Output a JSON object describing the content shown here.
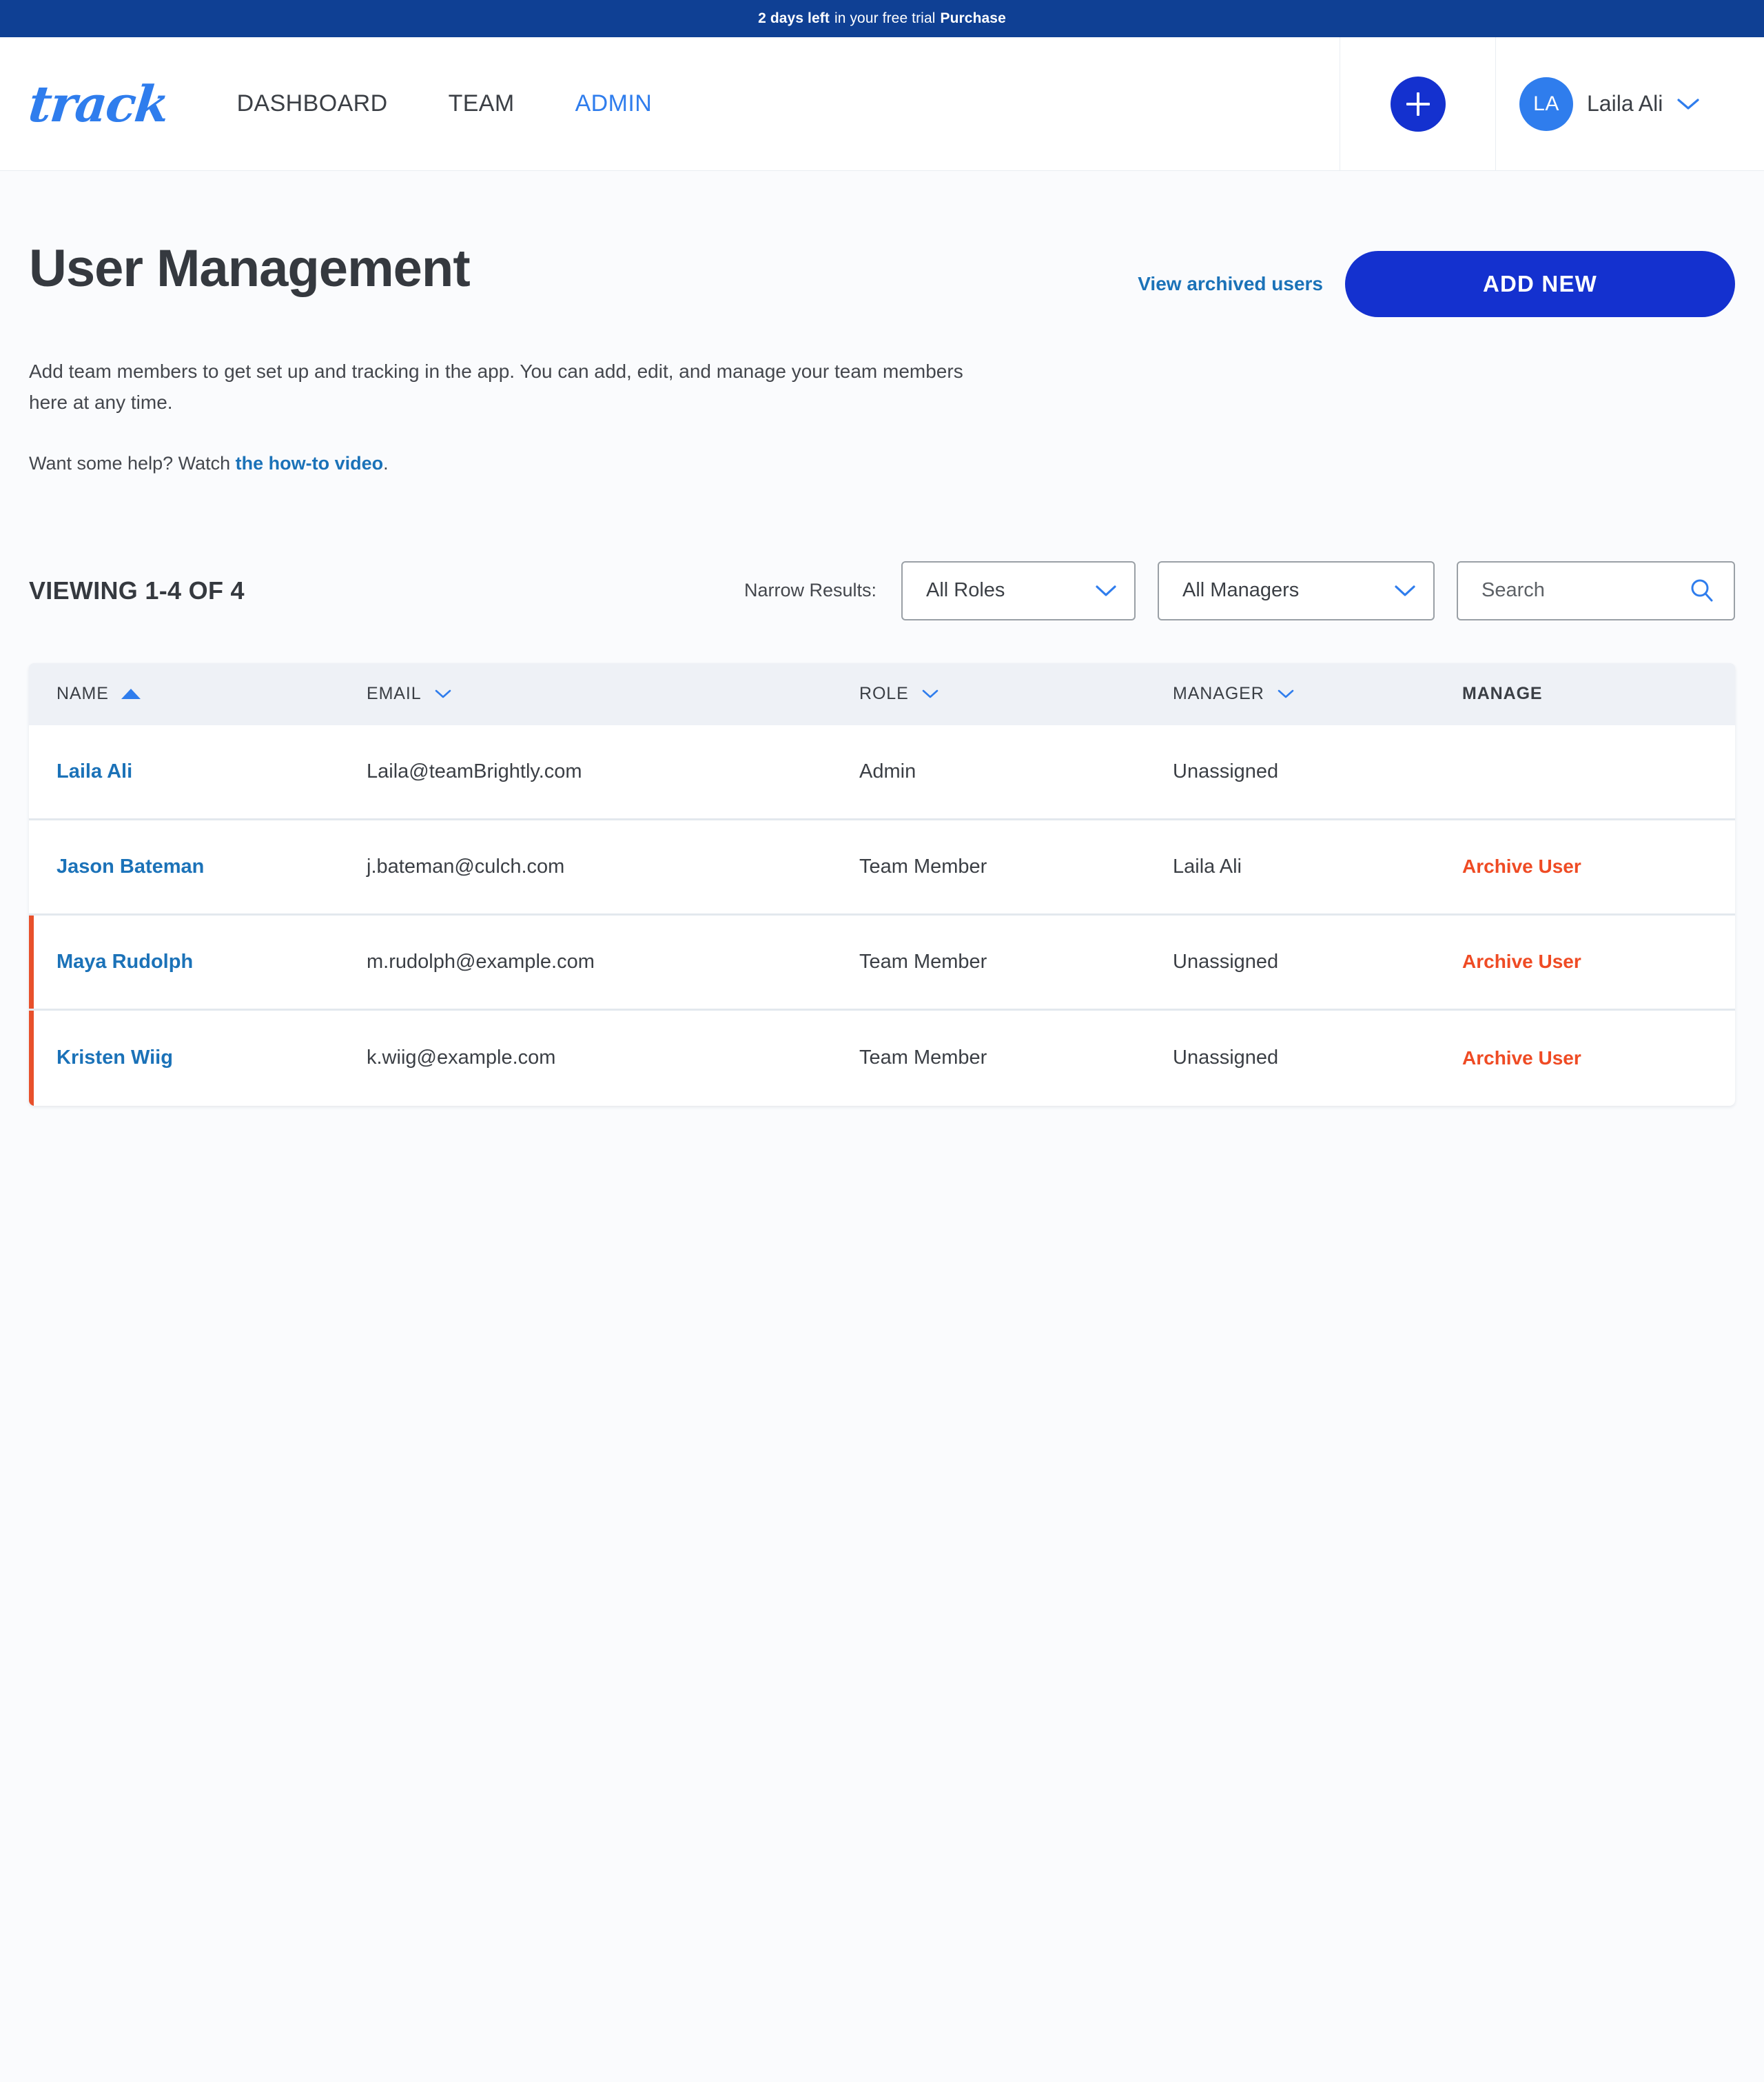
{
  "banner": {
    "bold_prefix": "2 days left",
    "text": "in your free trial",
    "cta": "Purchase"
  },
  "topnav": {
    "logo": "track",
    "items": [
      {
        "label": "DASHBOARD",
        "active": false
      },
      {
        "label": "TEAM",
        "active": false
      },
      {
        "label": "ADMIN",
        "active": true
      }
    ],
    "add_button_icon": "plus-icon",
    "user": {
      "initials": "LA",
      "name": "Laila Ali",
      "chevron_icon": "chevron-down-icon"
    }
  },
  "page": {
    "title": "User Management",
    "archived_link": "View archived users",
    "add_new_label": "ADD NEW",
    "intro": "Add team members to get set up and tracking in the app. You can add, edit, and manage your team members here at any time.",
    "help_prefix": "Want some help? Watch ",
    "help_link": "the how-to video",
    "help_suffix": "."
  },
  "filters": {
    "viewing": "VIEWING 1-4 OF 4",
    "narrow_label": "Narrow Results:",
    "role_select": {
      "value": "All Roles",
      "icon": "chevron-down-icon"
    },
    "manager_select": {
      "value": "All Managers",
      "icon": "chevron-down-icon"
    },
    "search": {
      "placeholder": "Search",
      "value": "",
      "icon": "search-icon"
    }
  },
  "table": {
    "columns": [
      {
        "label": "NAME",
        "sort": "asc",
        "icon": "sort-ascending-icon"
      },
      {
        "label": "EMAIL",
        "sort": "none",
        "icon": "chevron-down-icon"
      },
      {
        "label": "ROLE",
        "sort": "none",
        "icon": "chevron-down-icon"
      },
      {
        "label": "MANAGER",
        "sort": "none",
        "icon": "chevron-down-icon"
      },
      {
        "label": "MANAGE",
        "sort": null,
        "icon": null
      }
    ],
    "rows": [
      {
        "name": "Laila Ali",
        "email": "Laila@teamBrightly.com",
        "role": "Admin",
        "manager": "Unassigned",
        "manage": "",
        "flagged": false
      },
      {
        "name": "Jason Bateman",
        "email": "j.bateman@culch.com",
        "role": "Team Member",
        "manager": "Laila Ali",
        "manage": "Archive User",
        "flagged": false
      },
      {
        "name": "Maya Rudolph",
        "email": "m.rudolph@example.com",
        "role": "Team Member",
        "manager": "Unassigned",
        "manage": "Archive User",
        "flagged": true
      },
      {
        "name": "Kristen Wiig",
        "email": "k.wiig@example.com",
        "role": "Team Member",
        "manager": "Unassigned",
        "manage": "Archive User",
        "flagged": true
      }
    ]
  },
  "colors": {
    "banner_blue": "#0f4094",
    "brand_blue": "#2f7ded",
    "action_blue": "#1431cf",
    "link_blue": "#1b72b8",
    "alert_orange": "#ef4b24",
    "flag_border": "#e8502b",
    "page_bg": "#fafbfd",
    "table_header_bg": "#eef1f6"
  }
}
